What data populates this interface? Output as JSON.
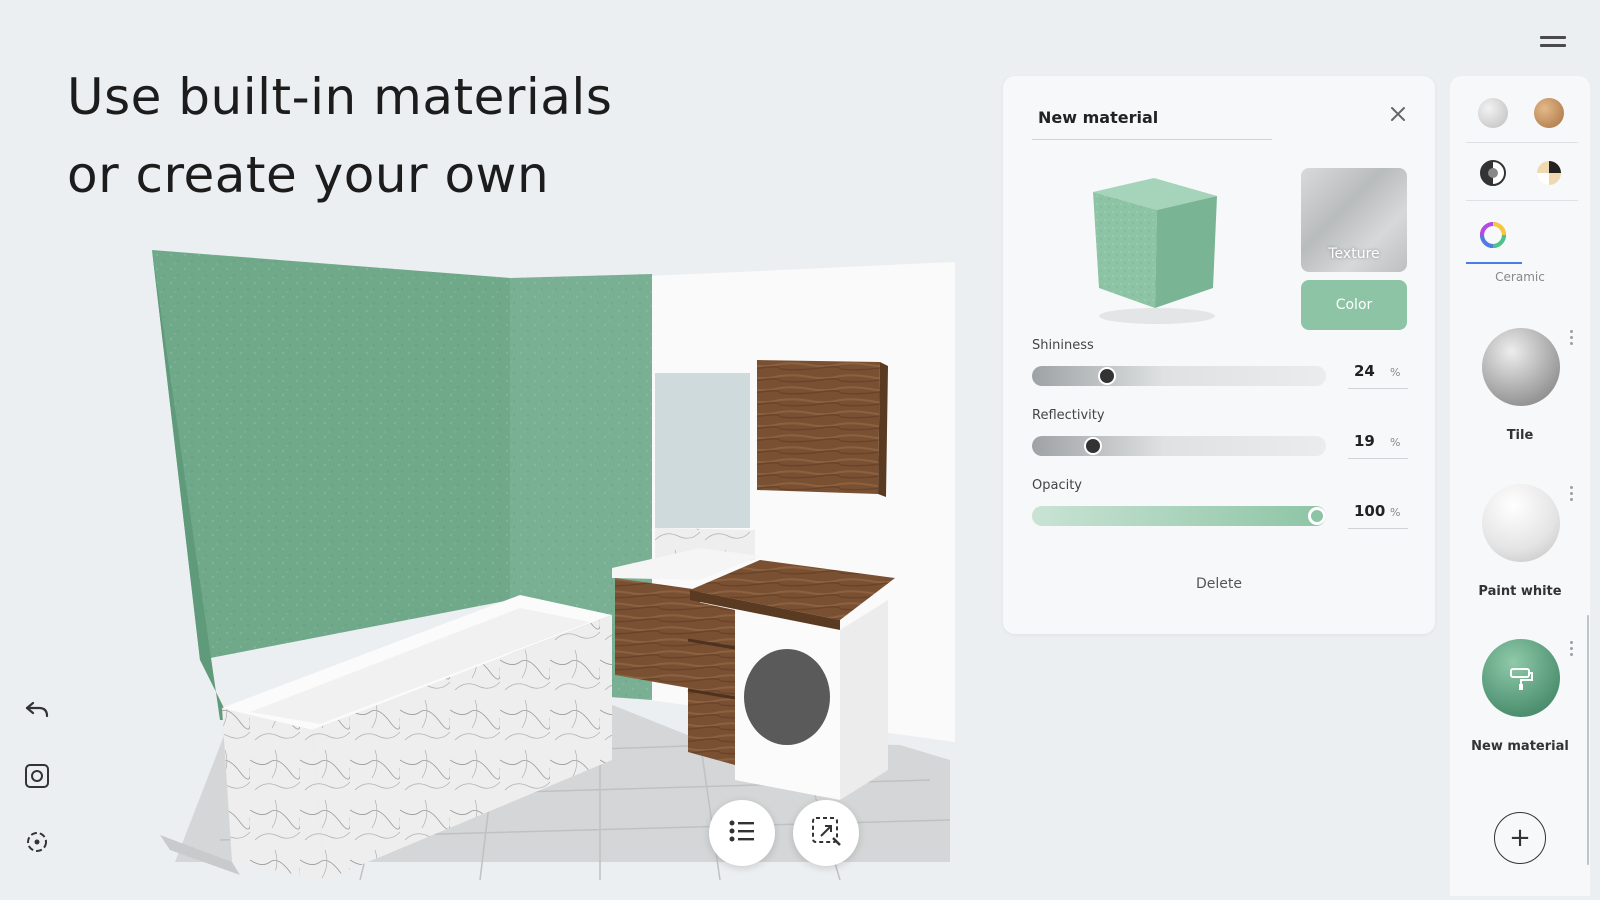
{
  "headline": {
    "line1": "Use built-in materials",
    "line2": "or create your own"
  },
  "material_panel": {
    "name_value": "New material",
    "texture_label": "Texture",
    "color_label": "Color",
    "accent_color": "#8dc4a5",
    "sliders": [
      {
        "label": "Shininess",
        "value": "24",
        "unit": "%",
        "level": 0.24
      },
      {
        "label": "Reflectivity",
        "value": "19",
        "unit": "%",
        "level": 0.19
      },
      {
        "label": "Opacity",
        "value": "100",
        "unit": "%",
        "level": 1.0
      }
    ],
    "delete_label": "Delete"
  },
  "sidebar": {
    "category_label": "Ceramic",
    "materials": [
      {
        "label": "Tile"
      },
      {
        "label": "Paint white"
      },
      {
        "label": "New material"
      }
    ],
    "add_label": "+"
  },
  "icons": {
    "menu": "menu-icon",
    "undo": "undo-icon",
    "screenshot": "camera-icon",
    "recenter": "focus-icon",
    "list": "list-icon",
    "select": "selection-icon",
    "close": "close-icon"
  }
}
